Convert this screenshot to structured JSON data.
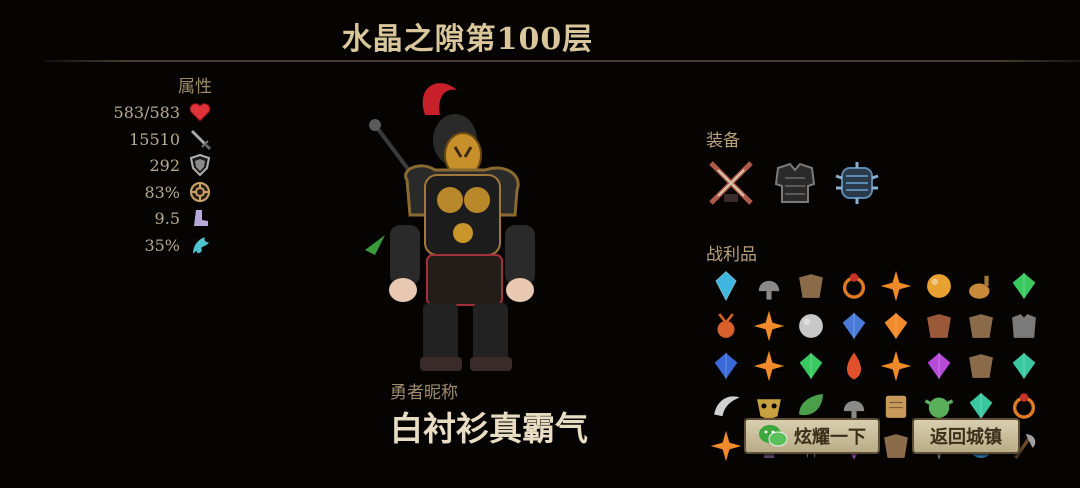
{
  "header": {
    "title": "水晶之隙第100层"
  },
  "attributes": {
    "title": "属性",
    "stats": [
      {
        "value": "583/583",
        "icon": "heart-icon",
        "color": "#e0323a"
      },
      {
        "value": "15510",
        "icon": "sword-icon",
        "color": "#9c9c9c"
      },
      {
        "value": "292",
        "icon": "shield-icon",
        "color": "#b0b0b0"
      },
      {
        "value": "83%",
        "icon": "gear-icon",
        "color": "#c9a56a"
      },
      {
        "value": "9.5",
        "icon": "boot-icon",
        "color": "#b8a8d8"
      },
      {
        "value": "35%",
        "icon": "dragon-icon",
        "color": "#4fc4cf"
      }
    ]
  },
  "hero": {
    "name_label": "勇者昵称",
    "name": "白衬衫真霸气"
  },
  "equipment": {
    "title": "装备",
    "items": [
      "crossed-swords-icon",
      "armor-icon",
      "spiked-bracer-icon"
    ]
  },
  "loot": {
    "title": "战利品",
    "items": [
      {
        "icon": "crystal-icon",
        "color": "#3fb6e0"
      },
      {
        "icon": "helmet-icon",
        "color": "#8a8a8a"
      },
      {
        "icon": "leather-icon",
        "color": "#8a6c4a"
      },
      {
        "icon": "ring-icon",
        "color": "#e07a24"
      },
      {
        "icon": "shuriken-icon",
        "color": "#f08a2a"
      },
      {
        "icon": "orb-icon",
        "color": "#e8a030"
      },
      {
        "icon": "potion-icon",
        "color": "#c88a3a"
      },
      {
        "icon": "gem-icon",
        "color": "#3ac860"
      },
      {
        "icon": "amulet-icon",
        "color": "#d8602a"
      },
      {
        "icon": "shuriken-icon",
        "color": "#f08a2a"
      },
      {
        "icon": "orb-icon",
        "color": "#c8c8c8"
      },
      {
        "icon": "gem-icon",
        "color": "#4a7ad8"
      },
      {
        "icon": "gem-icon",
        "color": "#f08a2a"
      },
      {
        "icon": "leather-icon",
        "color": "#9a5a3a"
      },
      {
        "icon": "leather-icon",
        "color": "#8a6c4a"
      },
      {
        "icon": "armor-icon",
        "color": "#7a7a7a"
      },
      {
        "icon": "gem-icon",
        "color": "#3a6ad8"
      },
      {
        "icon": "shuriken-icon",
        "color": "#f08a2a"
      },
      {
        "icon": "gem-icon",
        "color": "#3ac860"
      },
      {
        "icon": "flame-icon",
        "color": "#e0502a"
      },
      {
        "icon": "shuriken-icon",
        "color": "#f08a2a"
      },
      {
        "icon": "gem-icon",
        "color": "#b84ad8"
      },
      {
        "icon": "leather-icon",
        "color": "#8a6c4a"
      },
      {
        "icon": "gem-icon",
        "color": "#3ac8a0"
      },
      {
        "icon": "horn-icon",
        "color": "#d0d0d0"
      },
      {
        "icon": "mask-icon",
        "color": "#c8a040"
      },
      {
        "icon": "leaf-icon",
        "color": "#4aa04a"
      },
      {
        "icon": "helmet-icon",
        "color": "#8a8a8a"
      },
      {
        "icon": "scroll-icon",
        "color": "#c89a5a"
      },
      {
        "icon": "goblin-icon",
        "color": "#5ab05a"
      },
      {
        "icon": "gem-icon",
        "color": "#3ac8a0"
      },
      {
        "icon": "ring-icon",
        "color": "#e07a24"
      },
      {
        "icon": "shuriken-icon",
        "color": "#f08a2a"
      },
      {
        "icon": "skull-icon",
        "color": "#7a5a8a"
      },
      {
        "icon": "fang-icon",
        "color": "#d0d0d0"
      },
      {
        "icon": "gem-icon",
        "color": "#c04ad8"
      },
      {
        "icon": "leather-icon",
        "color": "#8a6c4a"
      },
      {
        "icon": "spike-icon",
        "color": "#9a9a9a"
      },
      {
        "icon": "orb-icon",
        "color": "#3a9ad8"
      },
      {
        "icon": "axe-icon",
        "color": "#a0a0a0"
      }
    ]
  },
  "actions": {
    "share_label": "炫耀一下",
    "return_label": "返回城镇"
  },
  "colors": {
    "accent": "#d9c69a",
    "button": "#d9ceb0"
  }
}
